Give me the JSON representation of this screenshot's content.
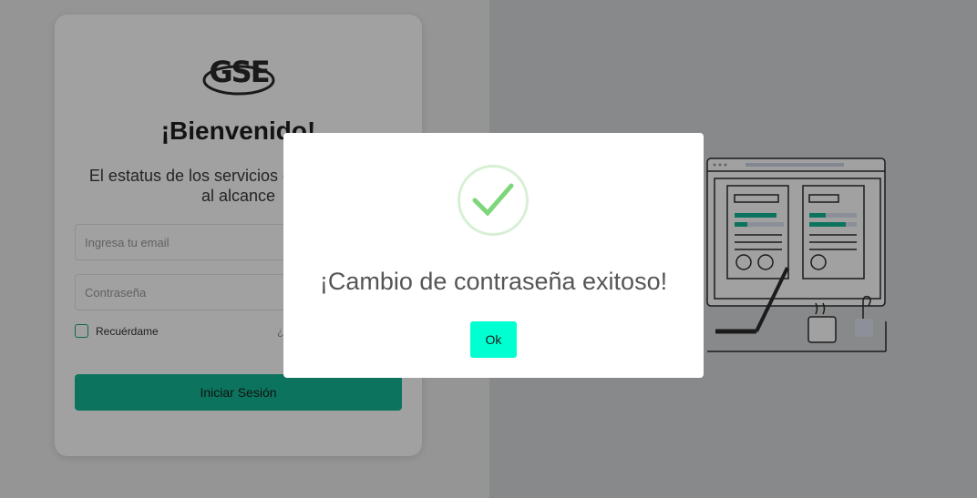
{
  "login": {
    "brand": "GSE",
    "welcome": "¡Bienvenido!",
    "subtitle": "El estatus de los servicios de tu empresa al alcance",
    "email_placeholder": "Ingresa tu email",
    "password_placeholder": "Contraseña",
    "remember_label": "Recuérdame",
    "forgot_fragment": "¿",
    "login_button": "Iniciar Sesión"
  },
  "modal": {
    "title": "¡Cambio de contraseña exitoso!",
    "ok_label": "Ok",
    "icon": "checkmark-circle-icon"
  },
  "colors": {
    "accent": "#13b895",
    "ok_button": "#00ffd1",
    "success_check": "#7ed67a"
  }
}
